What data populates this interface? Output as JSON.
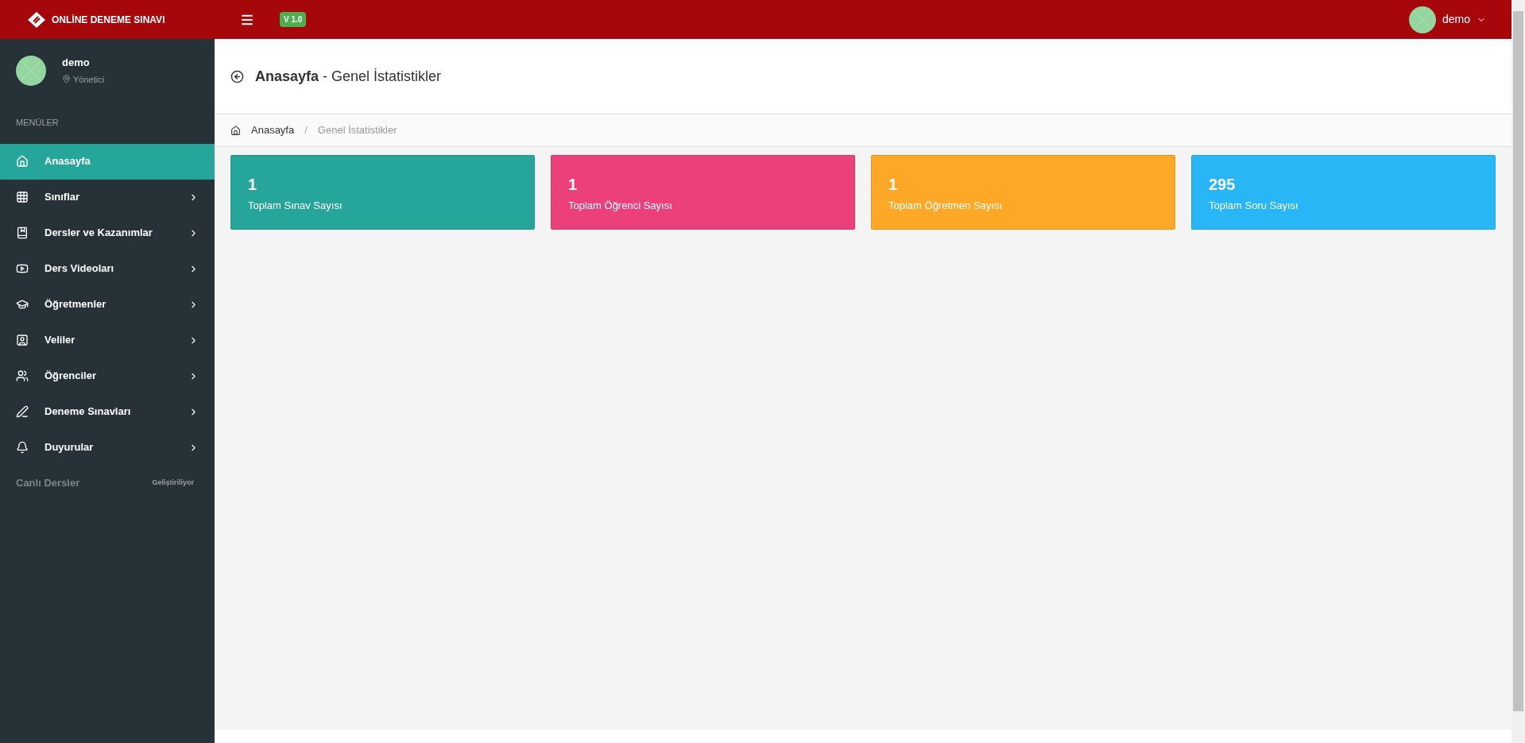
{
  "header": {
    "brand": "ONLİNE DENEME SINAVI",
    "version": "V 1.0",
    "user": "demo"
  },
  "sidebar": {
    "user": {
      "name": "demo",
      "role": "Yönetici"
    },
    "section": "MENÜLER",
    "items": [
      {
        "label": "Anasayfa",
        "selected": true,
        "has_submenu": false
      },
      {
        "label": "Sınıflar",
        "selected": false,
        "has_submenu": true
      },
      {
        "label": "Dersler ve Kazanımlar",
        "selected": false,
        "has_submenu": true
      },
      {
        "label": "Ders Videoları",
        "selected": false,
        "has_submenu": true
      },
      {
        "label": "Öğretmenler",
        "selected": false,
        "has_submenu": true
      },
      {
        "label": "Veliler",
        "selected": false,
        "has_submenu": true
      },
      {
        "label": "Öğrenciler",
        "selected": false,
        "has_submenu": true
      },
      {
        "label": "Deneme Sınavları",
        "selected": false,
        "has_submenu": true
      },
      {
        "label": "Duyurular",
        "selected": false,
        "has_submenu": true
      }
    ],
    "disabled_item": {
      "label": "Canlı Dersler",
      "note": "Geliştiriliyor"
    }
  },
  "page": {
    "title_bold": "Anasayfa",
    "title_rest": "- Genel İstatistikler"
  },
  "breadcrumb_separator": "/",
  "breadcrumb": [
    {
      "label": "Anasayfa",
      "selected": false
    },
    {
      "label": "Genel İstatistikler",
      "selected": true
    }
  ],
  "cards": [
    {
      "value": "1",
      "label": "Toplam Sınav Sayısı",
      "color": "#26a69a"
    },
    {
      "value": "1",
      "label": "Toplam Öğrenci Sayısı",
      "color": "#ec407a"
    },
    {
      "value": "1",
      "label": "Toplam Öğretmen Sayısı",
      "color": "#ffa726"
    },
    {
      "value": "295",
      "label": "Toplam Soru Sayısı",
      "color": "#29b6f6"
    }
  ]
}
